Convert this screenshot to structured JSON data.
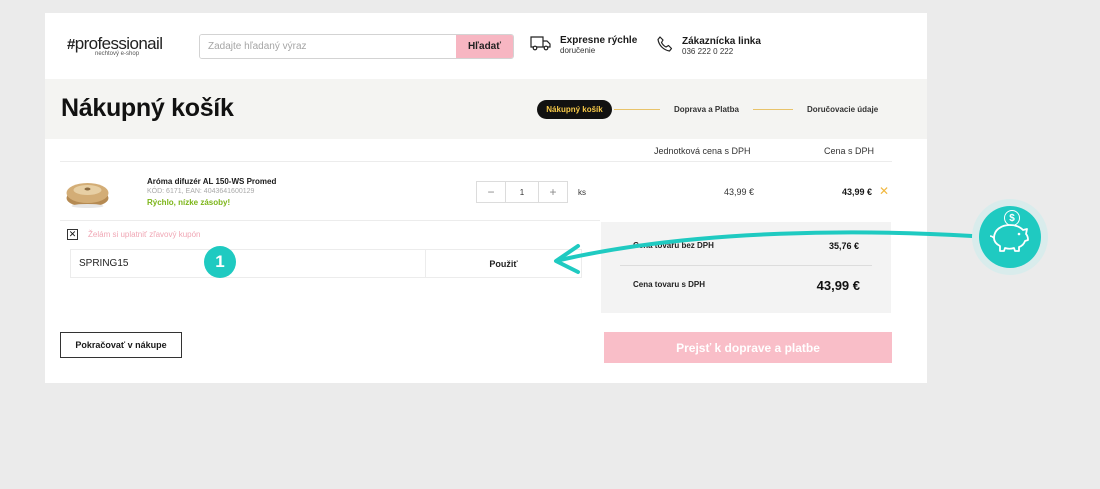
{
  "header": {
    "logo_main": "professionail",
    "logo_sub": "nechtový e-shop",
    "search_placeholder": "Zadajte hľadaný výraz",
    "search_button": "Hľadať",
    "delivery_title": "Expresne rýchle",
    "delivery_sub": "doručenie",
    "hotline_title": "Zákaznícka linka",
    "hotline_phone": "036 222 0 222"
  },
  "page": {
    "title": "Nákupný košík",
    "steps": [
      "Nákupný košík",
      "Doprava a Platba",
      "Doručovacie údaje"
    ],
    "active_step": 0
  },
  "table": {
    "col_unit_price": "Jednotková cena s DPH",
    "col_total": "Cena s DPH"
  },
  "product": {
    "name": "Aróma difuzér AL 150-WS Promed",
    "code": "KÓD: 6171, EAN: 4043641600129",
    "stock": "Rýchlo, nízke zásoby!",
    "quantity": "1",
    "qty_unit": "ks",
    "unit_price": "43,99 €",
    "total_price": "43,99 €",
    "decrease_symbol": "−",
    "increase_symbol": "+",
    "remove_symbol": "✕"
  },
  "coupon": {
    "checkbox_label": "Želám si uplatniť zľavový kupón",
    "code_value": "SPRING15",
    "apply_label": "Použiť",
    "badge_number": "1"
  },
  "summary": {
    "without_vat_label": "Cena tovaru bez DPH",
    "without_vat_value": "35,76 €",
    "with_vat_label": "Cena tovaru s DPH",
    "with_vat_value": "43,99 €"
  },
  "actions": {
    "continue_label": "Pokračovať v nákupe",
    "proceed_label": "Prejsť k doprave a platbe"
  },
  "colors": {
    "accent_pink": "#f7b6c2",
    "teal": "#1fcac1",
    "stock_green": "#7cb518",
    "step_gold": "#f7c948"
  },
  "icons": [
    "truck-icon",
    "phone-icon",
    "close-icon",
    "piggy-bank-icon",
    "dollar-coin-icon"
  ]
}
